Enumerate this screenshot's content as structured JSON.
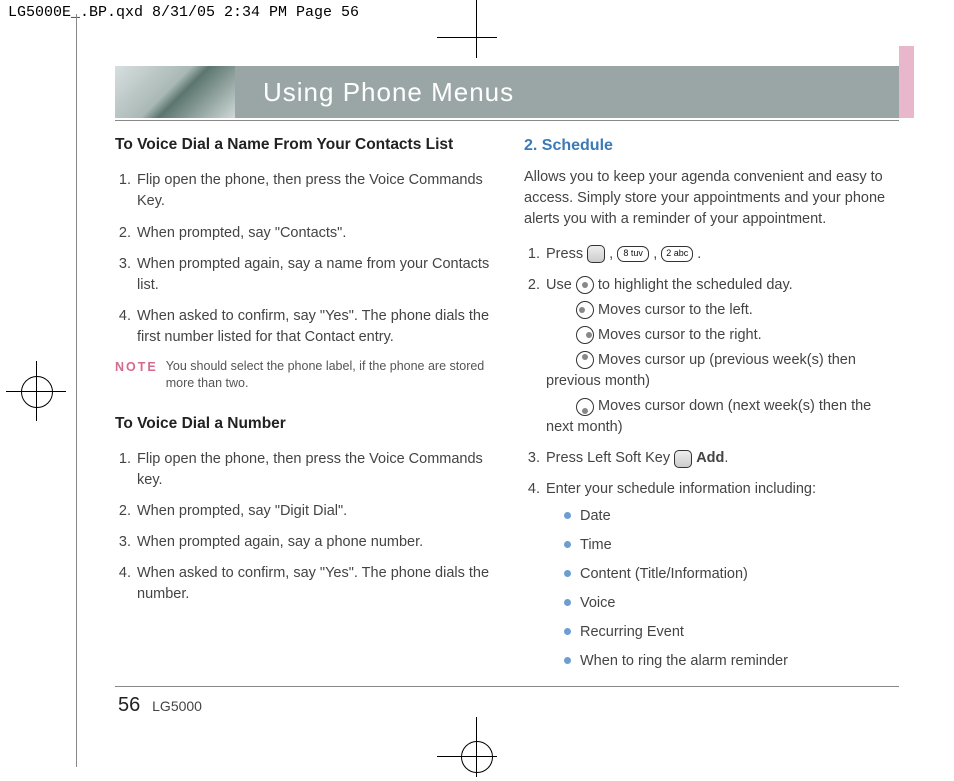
{
  "print_header": "LG5000E_.BP.qxd  8/31/05  2:34 PM  Page 56",
  "band_title": "Using Phone Menus",
  "left_col": {
    "h1": "To Voice Dial a Name From Your Contacts List",
    "steps1": [
      "Flip open the phone, then press the Voice Commands Key.",
      "When prompted, say \"Contacts\".",
      "When prompted again, say a name from your Contacts list.",
      "When asked to confirm, say \"Yes\". The phone dials the first number listed for that Contact entry."
    ],
    "note_label": "NOTE",
    "note_text": "You should select the phone label, if the  phone are stored more than two.",
    "h2": "To Voice Dial a Number",
    "steps2": [
      "Flip open the phone, then press the Voice Commands key.",
      "When prompted, say \"Digit Dial\".",
      "When prompted again, say a phone number.",
      "When asked to confirm, say \"Yes\". The phone dials the number."
    ]
  },
  "right_col": {
    "h1": "2. Schedule",
    "intro": "Allows you to keep your agenda convenient and easy to access. Simply store your appointments and your phone alerts you with a reminder of your appointment.",
    "step1_a": "Press ",
    "step1_key8": "8 tuv",
    "step1_key2": "2 abc",
    "step2_a": "Use ",
    "step2_b": " to highlight the scheduled day.",
    "nav_left": "Moves cursor to the left.",
    "nav_right": "Moves cursor to the right.",
    "nav_up": "Moves cursor up (previous week(s) then previous month)",
    "nav_down": "Moves cursor down (next week(s) then the next month)",
    "step3_a": "Press Left Soft Key ",
    "step3_b": "Add",
    "step4": "Enter your schedule information including:",
    "bullets": [
      "Date",
      "Time",
      "Content (Title/Information)",
      "Voice",
      "Recurring Event",
      "When to ring the alarm reminder"
    ]
  },
  "footer": {
    "page": "56",
    "model": "LG5000"
  }
}
